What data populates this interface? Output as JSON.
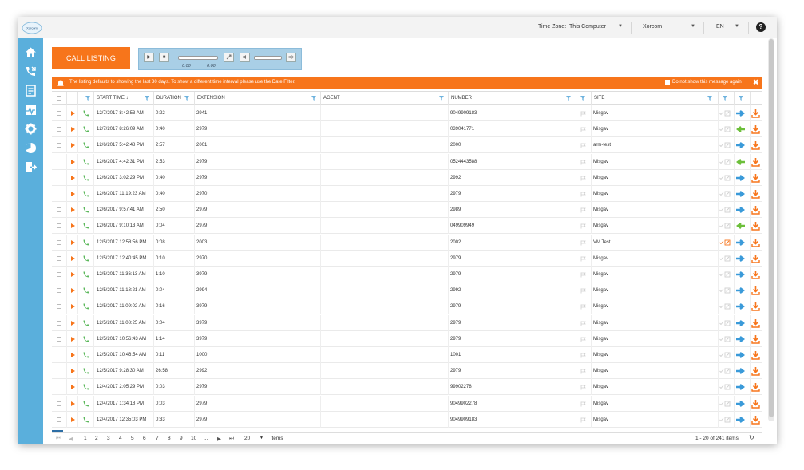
{
  "topbar": {
    "logo_text": "Xorcom",
    "timezone_label": "Time Zone:",
    "timezone_value": "This Computer",
    "account_value": "Xorcom",
    "language_value": "EN",
    "help_glyph": "?"
  },
  "sidebar": {
    "items": [
      {
        "icon": "home-icon"
      },
      {
        "icon": "phone-icon"
      },
      {
        "icon": "reports-icon"
      },
      {
        "icon": "monitor-icon"
      },
      {
        "icon": "gear-icon"
      },
      {
        "icon": "chart-icon"
      },
      {
        "icon": "logout-icon"
      }
    ]
  },
  "toolbar": {
    "call_listing_label": "CALL LISTING"
  },
  "player": {
    "play_glyph": "▶",
    "stop_glyph": "■",
    "current_time": "0:00",
    "total_time": "0:00"
  },
  "banner": {
    "message": "The listing defaults to showing the last 30 days. To show a different time interval please use the Date Filter.",
    "dont_show_label": "Do not show this message again",
    "close_glyph": "✖"
  },
  "grid": {
    "headers": {
      "start_time": "START TIME ↓",
      "duration": "DURATION",
      "extension": "EXTENSION",
      "agent": "AGENT",
      "number": "NUMBER",
      "site": "SITE"
    },
    "rows": [
      {
        "start": "12/7/2017 8:42:53 AM",
        "duration": "0:22",
        "ext": "2941",
        "number": "9049909183",
        "site": "Misgav",
        "dir": "out"
      },
      {
        "start": "12/7/2017 8:26:09 AM",
        "duration": "0:40",
        "ext": "2979",
        "number": "039041771",
        "site": "Misgav",
        "dir": "in"
      },
      {
        "start": "12/6/2017 5:42:48 PM",
        "duration": "2:57",
        "ext": "2001",
        "number": "2000",
        "site": "arm-test",
        "dir": "out"
      },
      {
        "start": "12/6/2017 4:42:31 PM",
        "duration": "2:53",
        "ext": "2979",
        "number": "0524443588",
        "site": "Misgav",
        "dir": "in"
      },
      {
        "start": "12/6/2017 3:02:29 PM",
        "duration": "0:40",
        "ext": "2979",
        "number": "2992",
        "site": "Misgav",
        "dir": "out"
      },
      {
        "start": "12/6/2017 11:19:23 AM",
        "duration": "0:40",
        "ext": "2970",
        "number": "2979",
        "site": "Misgav",
        "dir": "out"
      },
      {
        "start": "12/6/2017 9:57:41 AM",
        "duration": "2:50",
        "ext": "2979",
        "number": "2989",
        "site": "Misgav",
        "dir": "out"
      },
      {
        "start": "12/6/2017 9:10:13 AM",
        "duration": "0:04",
        "ext": "2979",
        "number": "049909949",
        "site": "Misgav",
        "dir": "in"
      },
      {
        "start": "12/5/2017 12:58:56 PM",
        "duration": "0:08",
        "ext": "2003",
        "number": "2002",
        "site": "VM Test",
        "dir": "out",
        "annotated": true
      },
      {
        "start": "12/5/2017 12:40:45 PM",
        "duration": "0:10",
        "ext": "2970",
        "number": "2979",
        "site": "Misgav",
        "dir": "out"
      },
      {
        "start": "12/5/2017 11:36:13 AM",
        "duration": "1:10",
        "ext": "3979",
        "number": "2979",
        "site": "Misgav",
        "dir": "out"
      },
      {
        "start": "12/5/2017 11:18:21 AM",
        "duration": "0:04",
        "ext": "2994",
        "number": "2992",
        "site": "Misgav",
        "dir": "out"
      },
      {
        "start": "12/5/2017 11:09:02 AM",
        "duration": "0:16",
        "ext": "3979",
        "number": "2979",
        "site": "Misgav",
        "dir": "out"
      },
      {
        "start": "12/5/2017 11:08:25 AM",
        "duration": "0:04",
        "ext": "3979",
        "number": "2979",
        "site": "Misgav",
        "dir": "out"
      },
      {
        "start": "12/5/2017 10:56:43 AM",
        "duration": "1:14",
        "ext": "3979",
        "number": "2979",
        "site": "Misgav",
        "dir": "out"
      },
      {
        "start": "12/5/2017 10:46:54 AM",
        "duration": "0:11",
        "ext": "1000",
        "number": "1001",
        "site": "Misgav",
        "dir": "out"
      },
      {
        "start": "12/5/2017 9:28:30 AM",
        "duration": "26:58",
        "ext": "2992",
        "number": "2979",
        "site": "Misgav",
        "dir": "out"
      },
      {
        "start": "12/4/2017 2:05:29 PM",
        "duration": "0:03",
        "ext": "2979",
        "number": "99902278",
        "site": "Misgav",
        "dir": "out"
      },
      {
        "start": "12/4/2017 1:34:18 PM",
        "duration": "0:03",
        "ext": "2979",
        "number": "9049902278",
        "site": "Misgav",
        "dir": "out"
      },
      {
        "start": "12/4/2017 12:35:03 PM",
        "duration": "0:33",
        "ext": "2979",
        "number": "9049909183",
        "site": "Misgav",
        "dir": "out"
      }
    ]
  },
  "pager": {
    "pages": [
      "1",
      "2",
      "3",
      "4",
      "5",
      "6",
      "7",
      "8",
      "9",
      "10",
      "..."
    ],
    "page_size": "20",
    "items_label": "items",
    "summary": "1 - 20 of 241 items"
  },
  "colors": {
    "accent": "#f7751b",
    "sidebar": "#5aafdc",
    "phone_green": "#5cb85c",
    "outbound_blue": "#3a9ad9",
    "inbound_green": "#6cbf3a"
  }
}
